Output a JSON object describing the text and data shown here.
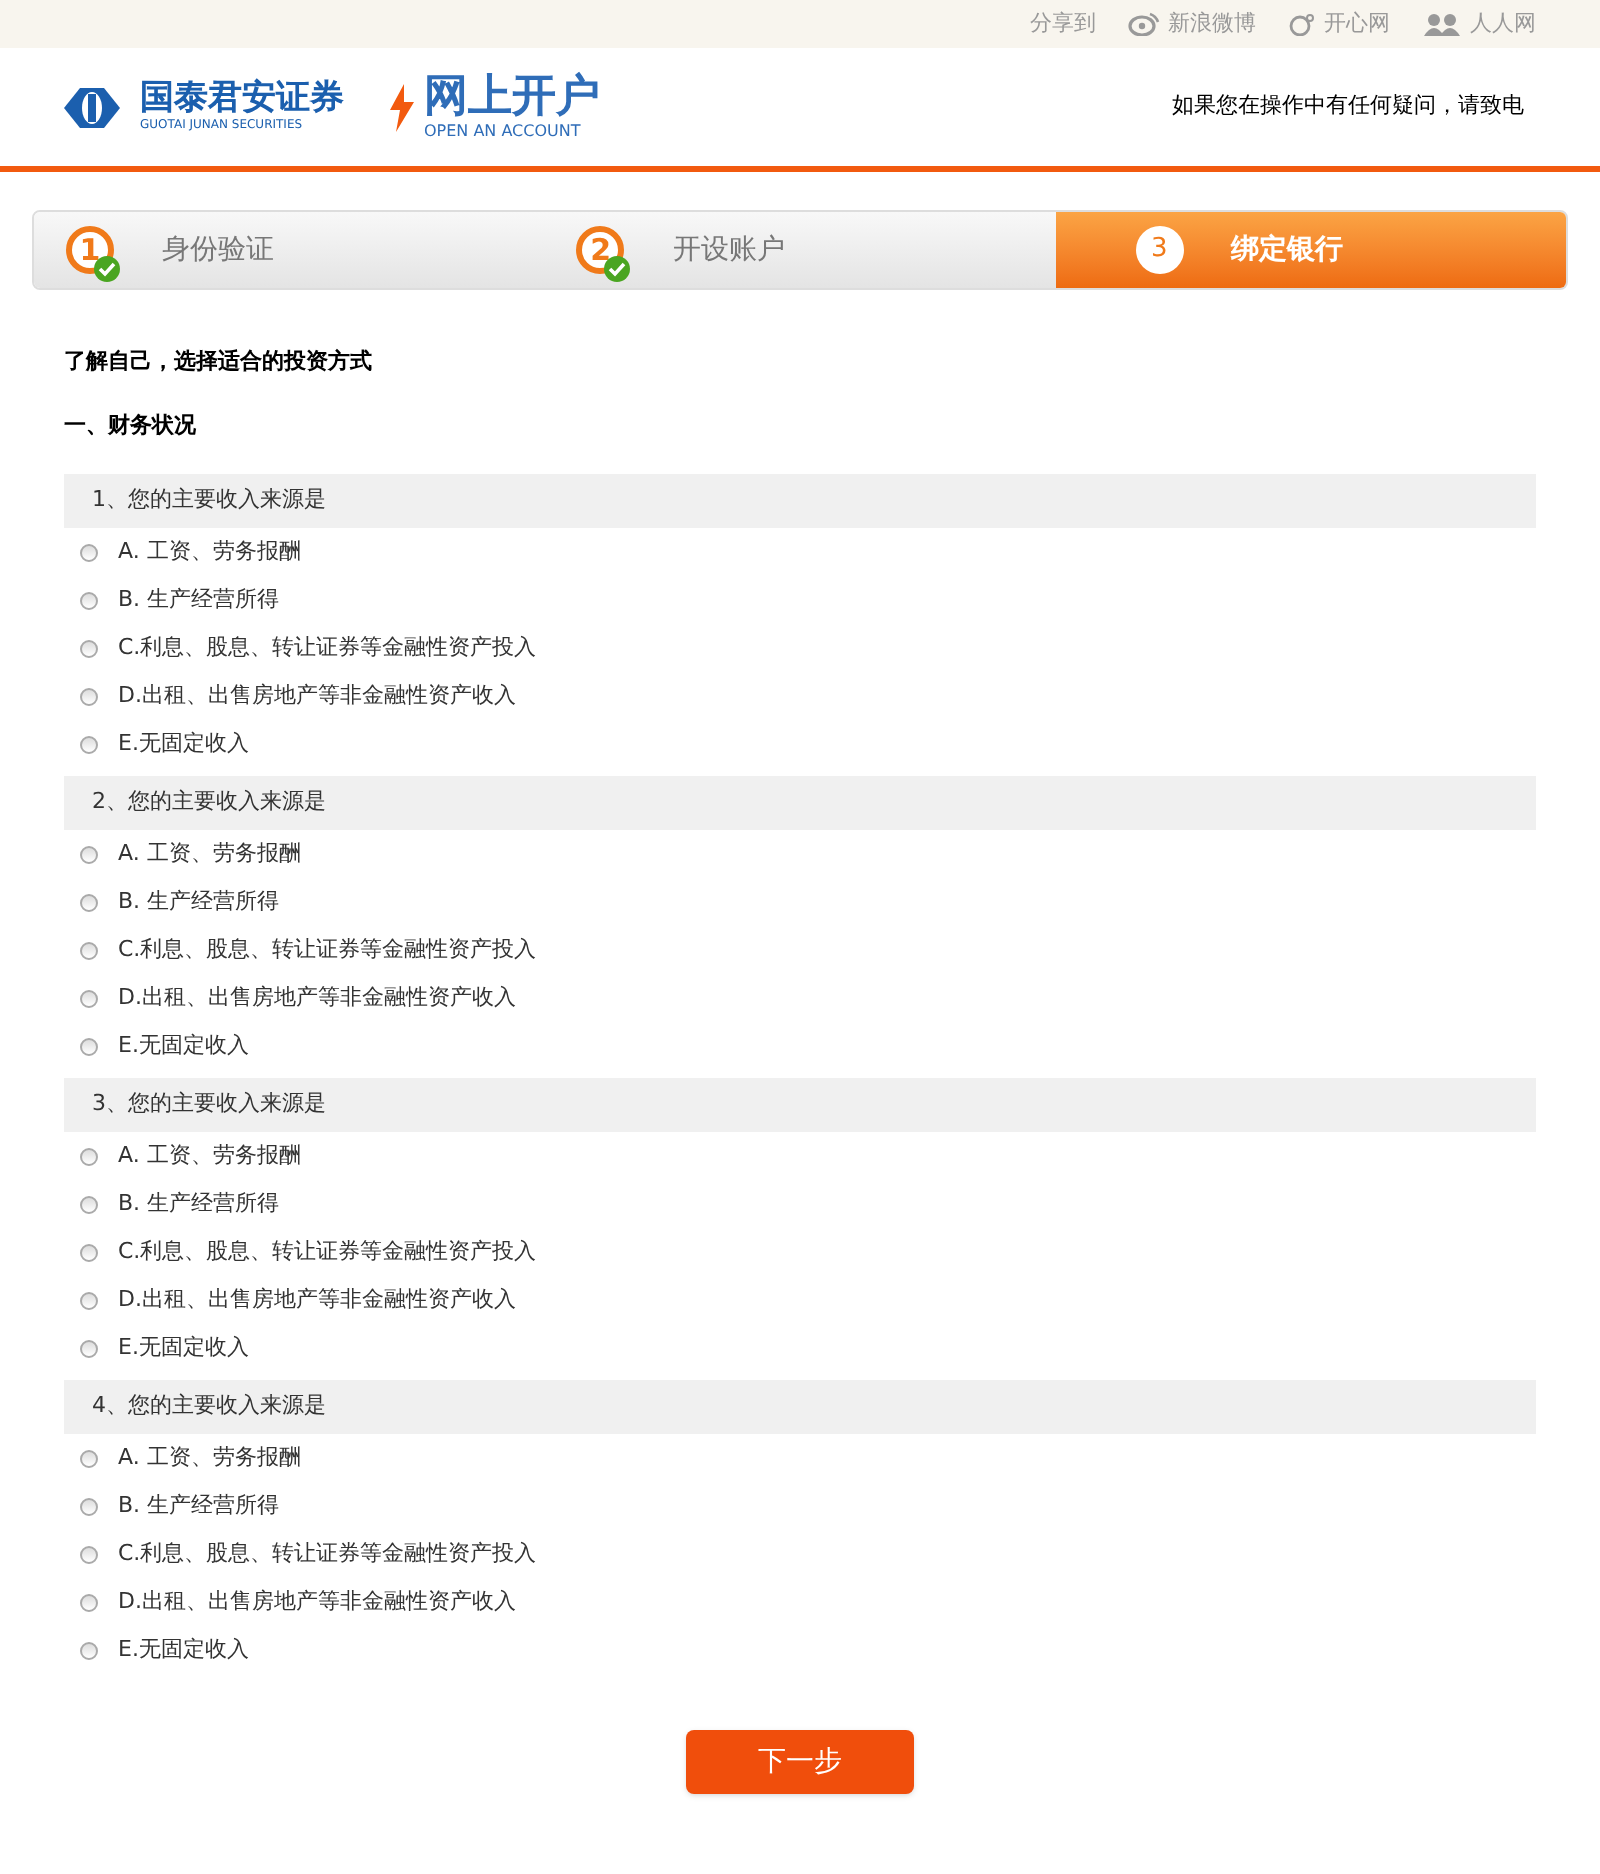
{
  "share_bar": {
    "label": "分享到",
    "links": [
      "新浪微博",
      "开心网",
      "人人网"
    ]
  },
  "header": {
    "brand": "国泰君安证券",
    "brand_en": "GUOTAI JUNAN SECURITIES",
    "service": "网上开户",
    "service_en": "OPEN AN ACCOUNT",
    "help_text": "如果您在操作中有任何疑问，请致电"
  },
  "steps": [
    {
      "number": "1",
      "label": "身份验证",
      "done": true,
      "selected": false
    },
    {
      "number": "2",
      "label": "开设账户",
      "done": true,
      "selected": false
    },
    {
      "number": "3",
      "label": "绑定银行",
      "done": false,
      "selected": true
    }
  ],
  "intro": "了解自己，选择适合的投资方式",
  "section": "一、财务状况",
  "questions": [
    {
      "title": "1、您的主要收入来源是",
      "options": [
        {
          "label": "A. 工资、劳务报酬",
          "selected": false
        },
        {
          "label": "B. 生产经营所得",
          "selected": false
        },
        {
          "label": "C.利息、股息、转让证券等金融性资产投入",
          "selected": false
        },
        {
          "label": "D.出租、出售房地产等非金融性资产收入",
          "selected": false
        },
        {
          "label": "E.无固定收入",
          "selected": false
        }
      ]
    },
    {
      "title": "2、您的主要收入来源是",
      "options": [
        {
          "label": "A. 工资、劳务报酬",
          "selected": false
        },
        {
          "label": "B. 生产经营所得",
          "selected": false
        },
        {
          "label": "C.利息、股息、转让证券等金融性资产投入",
          "selected": false
        },
        {
          "label": "D.出租、出售房地产等非金融性资产收入",
          "selected": false
        },
        {
          "label": "E.无固定收入",
          "selected": false
        }
      ]
    },
    {
      "title": "3、您的主要收入来源是",
      "options": [
        {
          "label": "A. 工资、劳务报酬",
          "selected": false
        },
        {
          "label": "B. 生产经营所得",
          "selected": false
        },
        {
          "label": "C.利息、股息、转让证券等金融性资产投入",
          "selected": false
        },
        {
          "label": "D.出租、出售房地产等非金融性资产收入",
          "selected": false
        },
        {
          "label": "E.无固定收入",
          "selected": false
        }
      ]
    },
    {
      "title": "4、您的主要收入来源是",
      "options": [
        {
          "label": "A. 工资、劳务报酬",
          "selected": false
        },
        {
          "label": "B. 生产经营所得",
          "selected": false
        },
        {
          "label": "C.利息、股息、转让证券等金融性资产投入",
          "selected": false
        },
        {
          "label": "D.出租、出售房地产等非金融性资产收入",
          "selected": false
        },
        {
          "label": "E.无固定收入",
          "selected": false
        }
      ]
    }
  ],
  "next_button": "下一步"
}
